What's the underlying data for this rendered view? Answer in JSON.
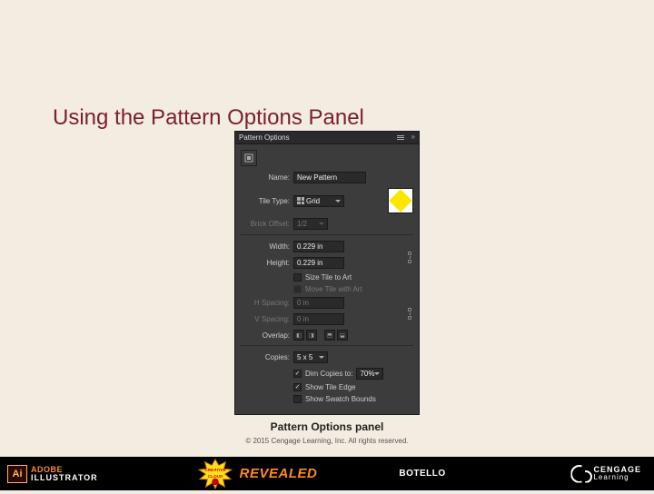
{
  "slide": {
    "title": "Using the Pattern Options Panel",
    "caption": "Pattern Options panel",
    "copyright": "© 2015 Cengage Learning, Inc. All rights reserved."
  },
  "panel": {
    "title": "Pattern Options",
    "fields": {
      "name_label": "Name:",
      "name_value": "New Pattern",
      "tile_type_label": "Tile Type:",
      "tile_type_value": "Grid",
      "brick_offset_label": "Brick Offset:",
      "brick_offset_value": "1/2",
      "width_label": "Width:",
      "width_value": "0.229 in",
      "height_label": "Height:",
      "height_value": "0.229 in",
      "size_tile_label": "Size Tile to Art",
      "move_tile_label": "Move Tile with Art",
      "h_spacing_label": "H Spacing:",
      "h_spacing_value": "0 in",
      "v_spacing_label": "V Spacing:",
      "v_spacing_value": "0 in",
      "overlap_label": "Overlap:",
      "copies_label": "Copies:",
      "copies_value": "5 x 5",
      "dim_copies_label": "Dim Copies to:",
      "dim_copies_value": "70%",
      "show_tile_edge_label": "Show Tile Edge",
      "show_swatch_bounds_label": "Show Swatch Bounds"
    }
  },
  "footer": {
    "product_top": "ADOBE",
    "product_bottom": "ILLUSTRATOR",
    "badge_top": "CREATIVE",
    "badge_bottom": "CLOUD",
    "revealed": "REVEALED",
    "author": "BOTELLO",
    "brand_top": "CENGAGE",
    "brand_bottom": "Learning"
  }
}
